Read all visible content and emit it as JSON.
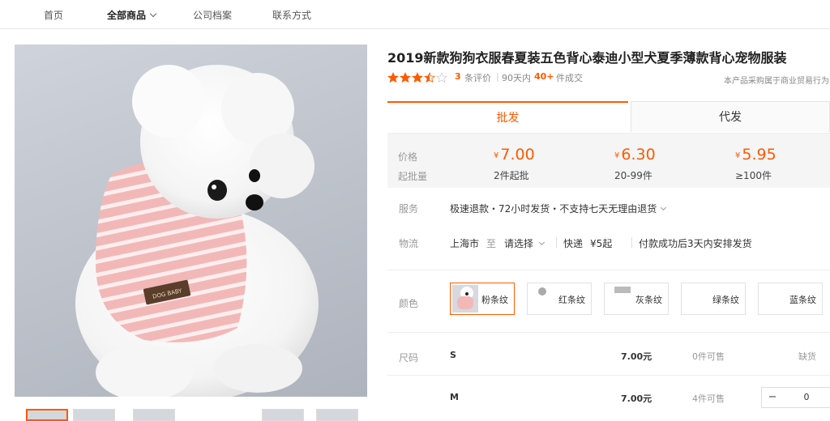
{
  "nav": {
    "items": [
      "首页",
      "全部商品",
      "公司档案",
      "联系方式"
    ]
  },
  "product": {
    "title": "2019新款狗狗衣服春夏装五色背心泰迪小型犬夏季薄款背心宠物服装",
    "rating": 3.5,
    "review_count": "3",
    "review_label": "条评价",
    "sales_prefix": "90天内",
    "sales_count": "40+",
    "sales_suffix": "件成交",
    "notice": "本产品采购属于商业贸易行为",
    "tag_text": "DOG BABY"
  },
  "tabs": [
    "批发",
    "代发"
  ],
  "pricing": {
    "price_label": "价格",
    "moq_label": "起批量",
    "currency": "¥",
    "tiers": [
      {
        "price": "7.00",
        "qty": "2件起批"
      },
      {
        "price": "6.30",
        "qty": "20-99件"
      },
      {
        "price": "5.95",
        "qty": "≥100件"
      }
    ]
  },
  "service": {
    "label": "服务",
    "text": "极速退款・72小时发货・不支持七天无理由退货"
  },
  "logistics": {
    "label": "物流",
    "from": "上海市",
    "to_word": "至",
    "select": "请选择",
    "express": "快递",
    "fee": "¥5起",
    "ship_note": "付款成功后3天内安排发货"
  },
  "colors": {
    "label": "颜色",
    "options": [
      {
        "name": "粉条纹",
        "selected": true
      },
      {
        "name": "红条纹",
        "selected": false
      },
      {
        "name": "灰条纹",
        "selected": false
      },
      {
        "name": "绿条纹",
        "selected": false
      },
      {
        "name": "蓝条纹",
        "selected": false
      }
    ]
  },
  "sizes": {
    "label": "尺码",
    "rows": [
      {
        "size": "S",
        "price": "7.00元",
        "stock": "0件可售",
        "status": "缺货"
      },
      {
        "size": "M",
        "price": "7.00元",
        "stock": "4件可售",
        "qty": "0"
      }
    ]
  },
  "accent_color": "#ff5a00",
  "star_color": "#ff5a00"
}
